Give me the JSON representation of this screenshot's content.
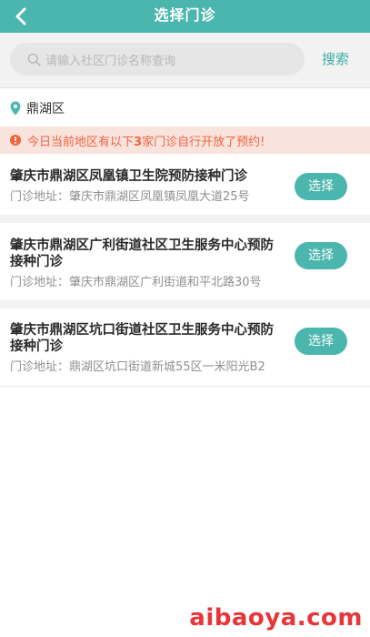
{
  "header": {
    "title": "选择门诊",
    "back_icon": "chevron-left-icon"
  },
  "search": {
    "placeholder": "请输入社区门诊名称查询",
    "button_label": "搜索",
    "icon": "search-icon"
  },
  "location": {
    "district": "鼎湖区",
    "icon": "map-pin-icon",
    "icon_color": "#4ab6ad"
  },
  "notice": {
    "icon": "alert-circle-icon",
    "prefix": "今日当前地区有以下",
    "count": "3",
    "suffix": "家门诊自行开放了预约!",
    "color": "#ef6540"
  },
  "clinics": [
    {
      "name": "肇庆市鼎湖区凤凰镇卫生院预防接种门诊",
      "address_label": "门诊地址：",
      "address": "肇庆市鼎湖区凤凰镇凤凰大道25号",
      "button_label": "选择"
    },
    {
      "name": "肇庆市鼎湖区广利街道社区卫生服务中心预防接种门诊",
      "address_label": "门诊地址：",
      "address": "肇庆市鼎湖区广利街道和平北路30号",
      "button_label": "选择"
    },
    {
      "name": "肇庆市鼎湖区坑口街道社区卫生服务中心预防接种门诊",
      "address_label": "门诊地址：",
      "address": "鼎湖区坑口街道新城55区一米阳光B2",
      "button_label": "选择"
    }
  ],
  "colors": {
    "primary": "#4ab6ad",
    "background": "#f2f2f2"
  },
  "watermark": "aibaoya.com"
}
